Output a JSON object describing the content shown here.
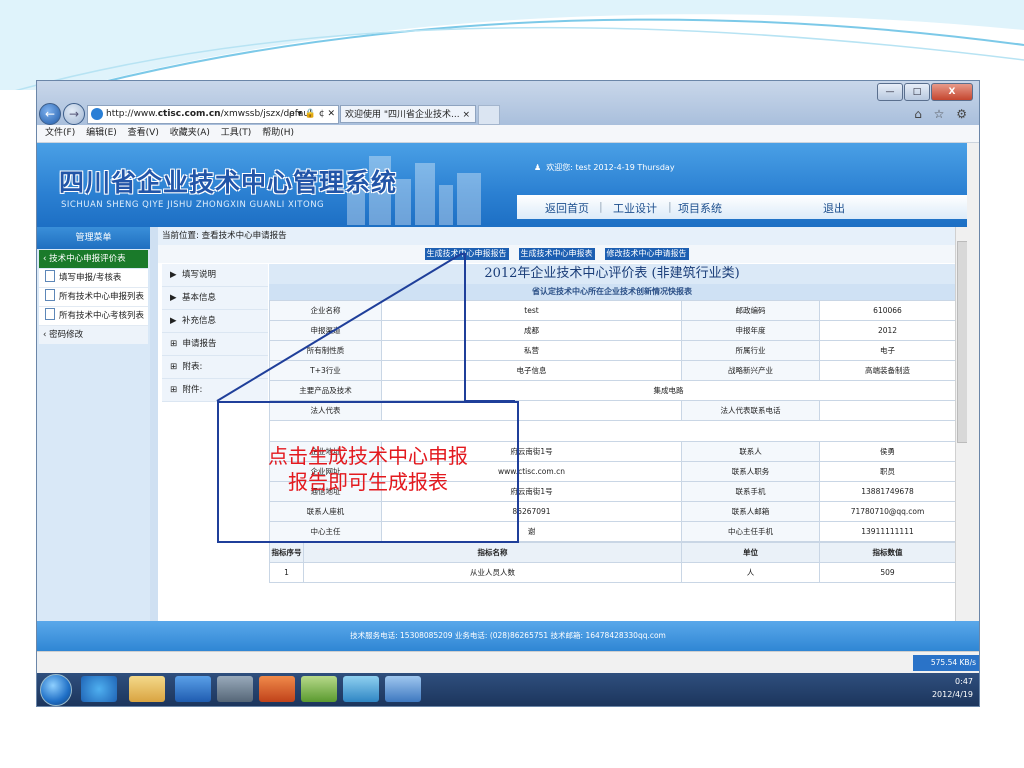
{
  "browser": {
    "address": {
      "prefix": "http://www.",
      "domain": "ctisc.com.cn",
      "path": "/xmwssb/jszx/defaul"
    },
    "addr_icons": "ρ ▾ 🔒 ¢ ✕",
    "tab_title": "欢迎使用 \"四川省企业技术... ×",
    "menu": [
      "文件(F)",
      "编辑(E)",
      "查看(V)",
      "收藏夹(A)",
      "工具(T)",
      "帮助(H)"
    ],
    "window_buttons": {
      "minimize": "—",
      "maximize": "□",
      "close": "X"
    },
    "toolbar_icons": "⌂ ☆ ⚙"
  },
  "header": {
    "title": "四川省企业技术中心管理系统",
    "subtitle": "SICHUAN SHENG QIYE JISHU ZHONGXIN GUANLI XITONG",
    "welcome": "欢迎您: test 2012-4-19 Thursday",
    "nav": [
      "返回首页",
      "工业设计",
      "项目系统",
      "退出"
    ]
  },
  "sidebar": {
    "heading": "管理菜单",
    "selected": "技术中心申报评价表",
    "items": [
      "填写申报/考核表",
      "所有技术中心申报列表",
      "所有技术中心考核列表"
    ],
    "password": "密码修改"
  },
  "content": {
    "breadcrumb": "当前位置: 查看技术中心申请报告",
    "links": [
      "生成技术中心申报报告",
      "生成技术中心申报表",
      "修改技术中心申请报告"
    ],
    "menu": [
      "填写说明",
      "基本信息",
      "补充信息",
      "申请报告",
      "附表:",
      "附件:"
    ],
    "menu_markers": [
      "▶",
      "▶",
      "▶",
      "⊞",
      "⊞",
      "⊞"
    ],
    "form_title": "2012年企业技术中心评价表 (非建筑行业类)",
    "form_subtitle": "省认定技术中心所在企业技术创新情况快报表",
    "rows": [
      [
        "企业名称",
        "test",
        "邮政编码",
        "610066"
      ],
      [
        "申报渠道",
        "成都",
        "申报年度",
        "2012"
      ],
      [
        "所有制性质",
        "私营",
        "所属行业",
        "电子"
      ],
      [
        "T+3行业",
        "电子信息",
        "战略新兴产业",
        "高端装备制造"
      ]
    ],
    "wide_row": [
      "主要产品及技术",
      "集成电路"
    ],
    "rep_row": [
      "法人代表",
      "",
      "法人代表联系电话",
      ""
    ],
    "rows2": [
      [
        "企业地址",
        "府云南街1号",
        "联系人",
        "侯勇"
      ],
      [
        "企业网址",
        "www.ctisc.com.cn",
        "联系人职务",
        "职员"
      ],
      [
        "通信地址",
        "府云南街1号",
        "联系手机",
        "13881749678"
      ],
      [
        "联系人座机",
        "86267091",
        "联系人邮箱",
        "71780710@qq.com"
      ],
      [
        "中心主任",
        "谢",
        "中心主任手机",
        "13911111111"
      ]
    ],
    "index_head": [
      "指标序号",
      "指标名称",
      "单位",
      "指标数值"
    ],
    "index_rows": [
      [
        "1",
        "从业人员人数",
        "人",
        "509"
      ]
    ]
  },
  "footer": {
    "text": "技术服务电话: 15308085209 业务电话: (028)86265751 技术邮箱: 16478428330qq.com"
  },
  "status": {
    "speed": "575.54 KB/s"
  },
  "tray": {
    "time": "0:47",
    "date": "2012/4/19"
  },
  "annotation": {
    "line1": "点击生成技术中心申报",
    "line2": "报告即可生成报表"
  }
}
